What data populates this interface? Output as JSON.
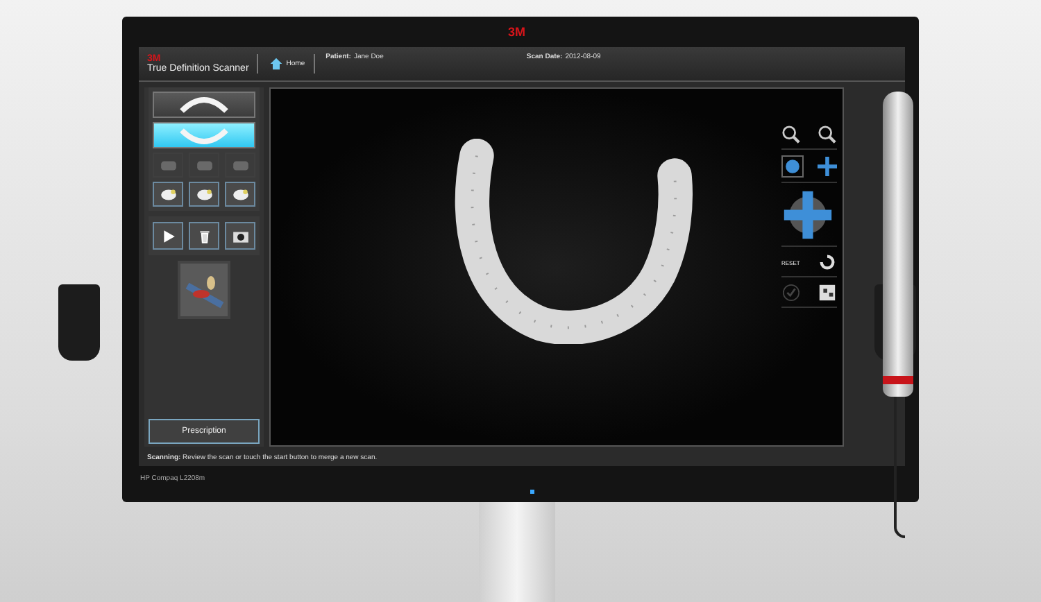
{
  "monitor": {
    "brand": "3M",
    "model": "HP Compaq L2208m"
  },
  "header": {
    "logo": "3M",
    "title": "True Definition Scanner",
    "home": "Home",
    "patient_label": "Patient:",
    "patient": "Jane Doe",
    "scan_date_label": "Scan Date:",
    "scan_date": "2012-08-09"
  },
  "arch_buttons": [
    {
      "selected": false
    },
    {
      "selected": true
    }
  ],
  "view_buttons": [
    {
      "disabled": true
    },
    {
      "disabled": true
    },
    {
      "disabled": true
    }
  ],
  "tool_buttons": [
    {
      "disabled": false
    },
    {
      "disabled": false
    },
    {
      "disabled": false
    }
  ],
  "prescription": "Prescription",
  "toolbar": {
    "reset_label": "RESET",
    "confirm_disabled": true
  },
  "status": "**Scanning:** Review the scan or touch the start button to merge a new scan."
}
